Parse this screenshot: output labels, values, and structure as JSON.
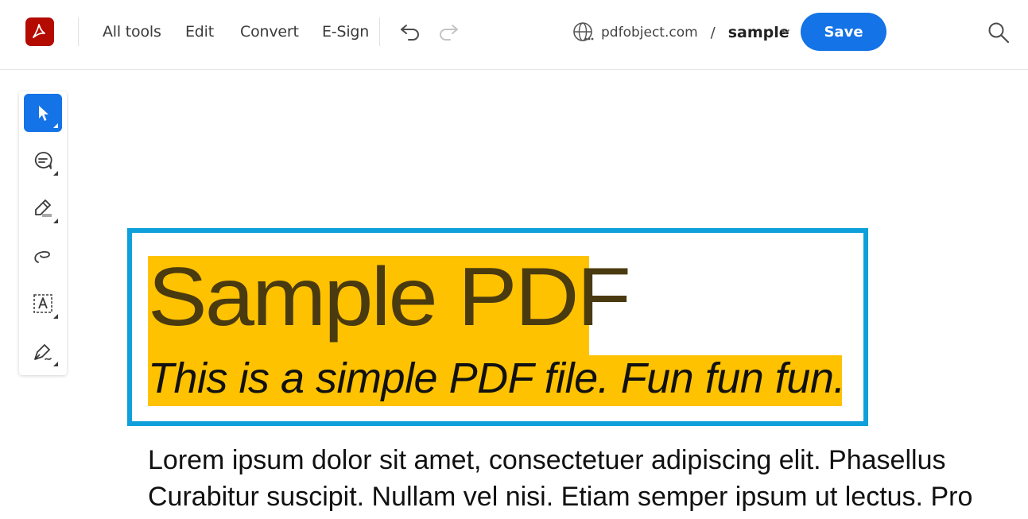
{
  "app": {
    "logo_icon": "acrobat-logo-icon",
    "brand_color": "#b30b00",
    "accent_color": "#1473e6"
  },
  "menu": {
    "all_tools": "All tools",
    "edit": "Edit",
    "convert": "Convert",
    "esign": "E-Sign"
  },
  "toolbar": {
    "undo_icon": "undo-icon",
    "redo_icon": "redo-icon"
  },
  "document": {
    "domain": "pdfobject.com",
    "separator": "/",
    "name": "sample",
    "save_label": "Save"
  },
  "tools": [
    {
      "name": "select-tool",
      "icon": "cursor-arrow-icon",
      "active": true
    },
    {
      "name": "comment-tool",
      "icon": "comment-icon",
      "active": false
    },
    {
      "name": "highlight-tool",
      "icon": "highlighter-icon",
      "active": false
    },
    {
      "name": "draw-tool",
      "icon": "freehand-draw-icon",
      "active": false
    },
    {
      "name": "text-tool",
      "icon": "text-box-icon",
      "active": false
    },
    {
      "name": "sign-tool",
      "icon": "pen-nib-icon",
      "active": false
    }
  ],
  "pdf": {
    "title": "Sample PDF",
    "subtitle": "This is a simple PDF file. Fun fun fun.",
    "body_lines": [
      "Lorem ipsum dolor sit amet, consectetuer adipiscing elit. Phasellus",
      "Curabitur suscipit. Nullam vel nisi. Etiam semper ipsum ut lectus. Pro"
    ],
    "highlight_color": "#ffc200",
    "selection_color": "#0fa0dc"
  }
}
